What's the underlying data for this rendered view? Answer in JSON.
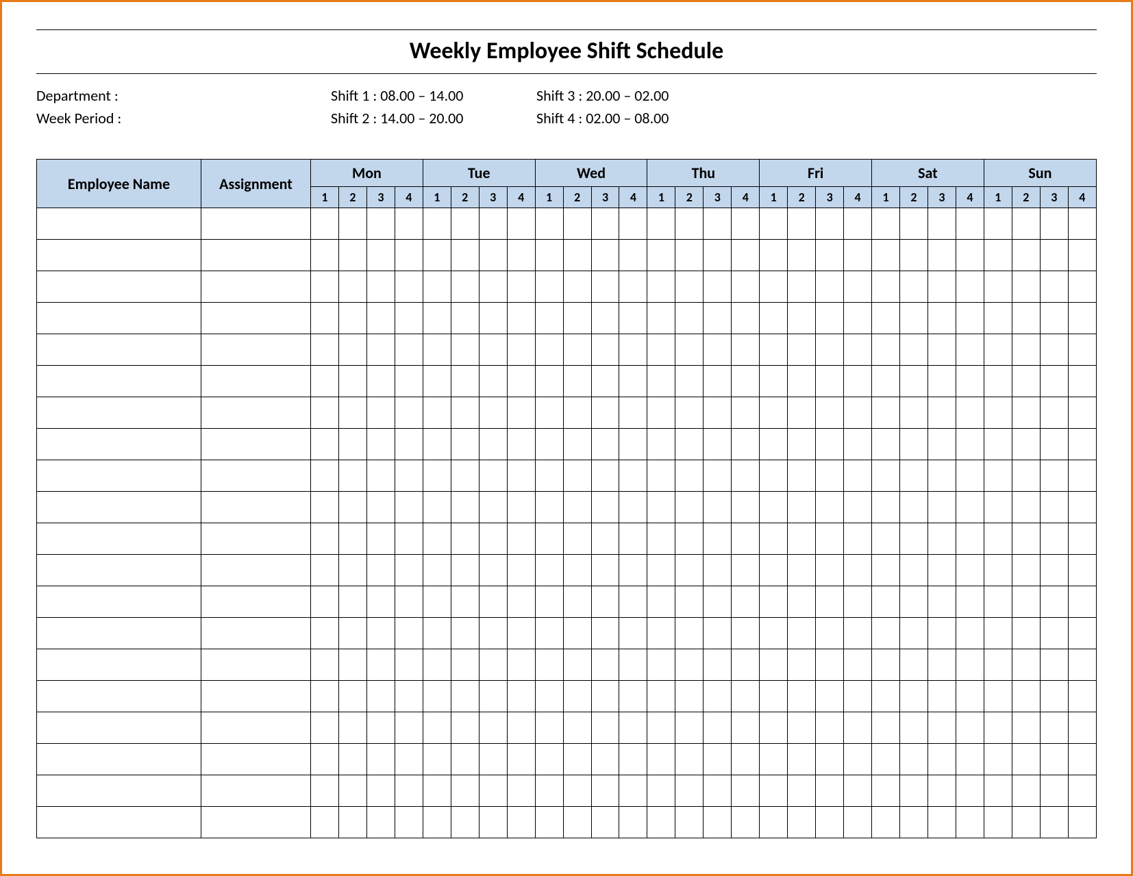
{
  "title": "Weekly Employee Shift Schedule",
  "meta": {
    "department_label": "Department    :",
    "week_period_label": "Week  Period :",
    "shift1": "Shift 1  : 08.00  – 14.00",
    "shift2": "Shift 2  : 14.00  – 20.00",
    "shift3": "Shift 3  : 20.00  – 02.00",
    "shift4": "Shift 4  : 02.00  – 08.00"
  },
  "headers": {
    "employee_name": "Employee Name",
    "assignment": "Assignment",
    "days": [
      "Mon",
      "Tue",
      "Wed",
      "Thu",
      "Fri",
      "Sat",
      "Sun"
    ],
    "shifts": [
      "1",
      "2",
      "3",
      "4"
    ]
  },
  "row_count": 20
}
